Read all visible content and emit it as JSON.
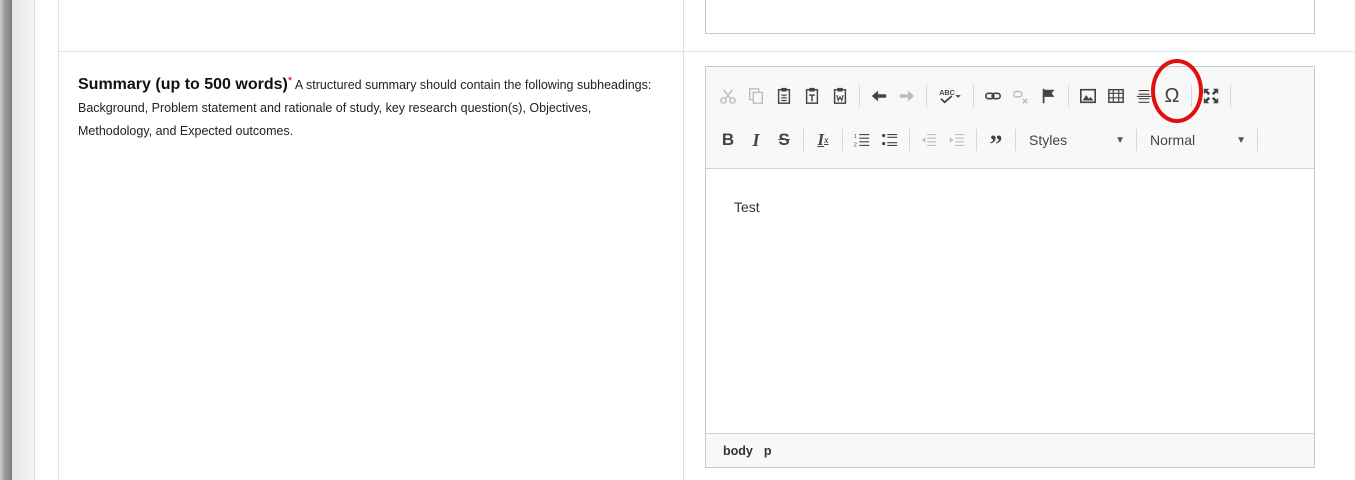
{
  "form": {
    "field_title": "Summary (up to 500 words)",
    "required_marker": "*",
    "field_description": " A structured summary should contain the following subheadings: Background, Problem statement and rationale of study, key research question(s), Objectives, Methodology, and Expected outcomes."
  },
  "editor": {
    "toolbar_row1": [
      "cut-icon",
      "copy-icon",
      "paste-icon",
      "paste-text-icon",
      "paste-word-icon",
      "undo-icon",
      "redo-icon",
      "spellcheck-icon",
      "link-icon",
      "unlink-icon",
      "anchor-icon",
      "image-icon",
      "table-icon",
      "horizontal-line-icon",
      "special-char-icon",
      "maximize-icon"
    ],
    "toolbar_row2": [
      "bold-icon",
      "italic-icon",
      "strike-icon",
      "remove-format-icon",
      "numbered-list-icon",
      "bulleted-list-icon",
      "outdent-icon",
      "indent-icon",
      "blockquote-icon"
    ],
    "styles_label": "Styles",
    "format_label": "Normal",
    "content_text": "Test",
    "status_path": [
      "body",
      "p"
    ]
  },
  "annotation": {
    "highlight_color": "#e01010",
    "highlighted_button": "image-icon"
  }
}
